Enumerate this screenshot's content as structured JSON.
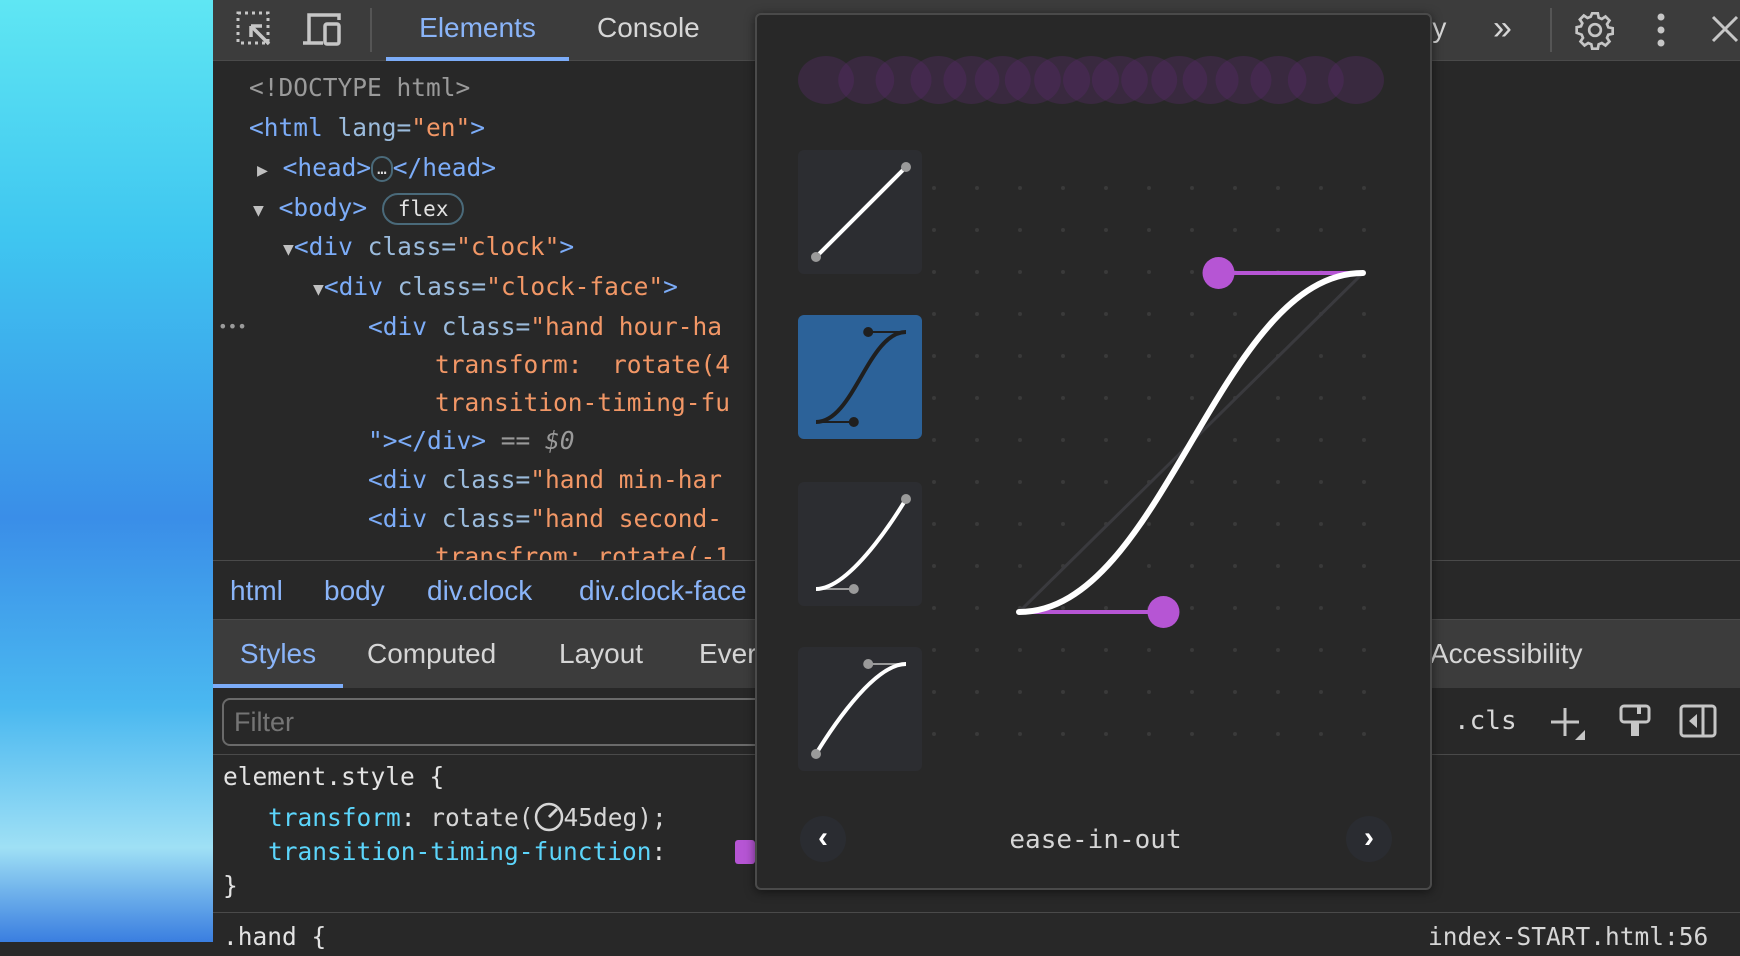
{
  "toolbar": {
    "tabs": [
      {
        "label": "Elements",
        "active": true
      },
      {
        "label": "Console"
      }
    ],
    "partial_tab": "ry",
    "more_tabs": "»",
    "icons": [
      "inspect-element-icon",
      "device-toggle-icon",
      "gear-icon",
      "kebab-menu-icon",
      "close-icon"
    ]
  },
  "dom": {
    "doctype": "<!DOCTYPE html>",
    "html_open": "<html ",
    "html_attr": "lang=",
    "html_val": "\"en\"",
    "html_close": ">",
    "head_open": "<head>",
    "head_ellipsis": "…",
    "head_close": "</head>",
    "body": "<body>",
    "body_badge": "flex",
    "clock_open": "<div ",
    "clock_attr": "class=",
    "clock_val": "\"clock\"",
    "clock_close": ">",
    "face_open": "<div ",
    "face_attr": "class=",
    "face_val": "\"clock-face\"",
    "face_close": ">",
    "hour_open": "<div ",
    "hour_attr": "class=",
    "hour_val": "\"hand hour-ha",
    "hour_style1": "transform:  rotate(4",
    "hour_style2": "transition-timing-fu",
    "hour_end": "\"></div>",
    "hour_eq": " == ",
    "hour_sel": "$0",
    "min_open": "<div ",
    "min_attr": "class=",
    "min_val": "\"hand min-har",
    "sec_open": "<div ",
    "sec_attr": "class=",
    "sec_val": "\"hand second-",
    "sec_style": "transfrom: rotate(-1",
    "gutter_dots": "•••"
  },
  "breadcrumbs": [
    "html",
    "body",
    "div.clock",
    "div.clock-face"
  ],
  "subtabs": [
    {
      "label": "Styles",
      "active": true
    },
    {
      "label": "Computed"
    },
    {
      "label": "Layout"
    },
    {
      "label": "Ever"
    },
    {
      "label": "Accessibility"
    }
  ],
  "filter": {
    "placeholder": "Filter",
    "cls": ".cls"
  },
  "styles": {
    "selector": "element.style {",
    "prop1": "transform",
    "val1_pre": "rotate(",
    "val1_post": "45deg);",
    "prop2": "transition-timing-function",
    "colon": ":",
    "close": "}",
    "next_rule": ".hand {",
    "source": "index-START.html:56"
  },
  "easing_editor": {
    "selected": "ease-in-out",
    "curve": [
      0.42,
      0,
      0.58,
      1
    ],
    "presets": [
      {
        "name": "linear",
        "curve": [
          0,
          0,
          1,
          1
        ]
      },
      {
        "name": "ease-in-out",
        "curve": [
          0.42,
          0,
          0.58,
          1
        ],
        "selected": true
      },
      {
        "name": "ease-in",
        "curve": [
          0.42,
          0,
          1,
          1
        ]
      },
      {
        "name": "ease-out",
        "curve": [
          0,
          0,
          0.58,
          1
        ]
      }
    ],
    "accent": "#b655d4",
    "selected_bg": "#2c6299"
  },
  "colors": {
    "tag": "#7cacf8",
    "value": "#f29766",
    "property": "#5cd5fb",
    "active_tab": "#8ab4f8"
  }
}
